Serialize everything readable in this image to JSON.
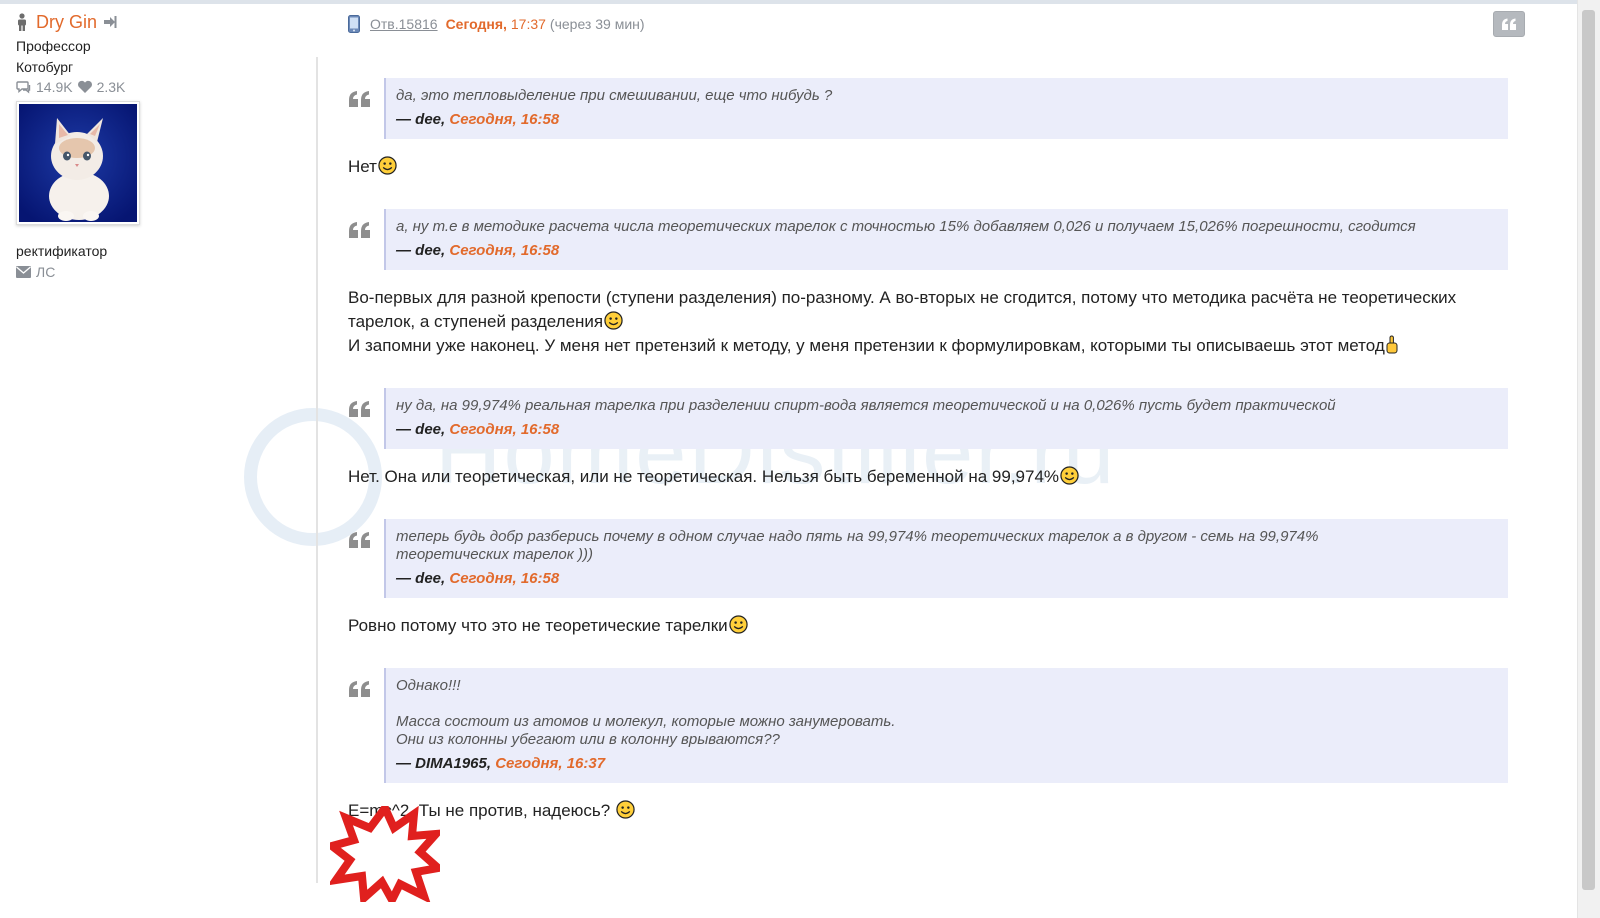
{
  "user": {
    "name": "Dry Gin",
    "rank": "Профессор",
    "city": "Котобург",
    "posts_count": "14.9K",
    "likes_count": "2.3K",
    "role": "ректификатор",
    "pm_label": "ЛС"
  },
  "post": {
    "number": "Отв.15816",
    "date": "Сегодня,",
    "time": "17:37",
    "delay": "(через 39 мин)"
  },
  "watermark": "HomeDistiller.ru",
  "blocks": [
    {
      "quote_lines": [
        "да, это тепловыделение при смешивании, еще что нибудь ?"
      ],
      "quote_author": "— dee,",
      "quote_time": "Сегодня, 16:58",
      "answer_lines": [
        "Нет"
      ]
    },
    {
      "quote_lines": [
        "а, ну т.е в методике расчета числа теоретических тарелок с точностью 15% добавляем 0,026 и получаем 15,026% погрешности, сгодится"
      ],
      "quote_author": "— dee,",
      "quote_time": "Сегодня, 16:58",
      "answer_lines": [
        "Во-первых для разной крепости (ступени разделения) по-разному. А во-вторых не сгодится, потому что методика расчёта не теоретических",
        "тарелок, а ступеней разделения",
        "И запомни уже наконец. У меня нет претензий к методу, у меня претензии к формулировкам, которыми ты описываешь этот метод"
      ]
    },
    {
      "quote_lines": [
        "ну да, на 99,974% реальная тарелка при разделении спирт-вода является теоретической и на 0,026% пусть будет практической"
      ],
      "quote_author": "— dee,",
      "quote_time": "Сегодня, 16:58",
      "answer_lines": [
        "Нет. Она или теоретическая, или не теоретическая. Нельзя быть беременной на 99,974%"
      ]
    },
    {
      "quote_lines": [
        "теперь будь добр разберись почему в одном случае надо пять на 99,974% теоретических тарелок а в другом - семь на 99,974%",
        "теоретических тарелок )))"
      ],
      "quote_author": "— dee,",
      "quote_time": "Сегодня, 16:58",
      "answer_lines": [
        "Ровно потому что это не теоретические тарелки"
      ]
    },
    {
      "quote_lines": [
        "Однако!!!",
        "Масса состоит из атомов и молекул, которые можно занумеровать.",
        "Они из колонны убегают или в колонну врываются??"
      ],
      "quote_author": "— DIMA1965,",
      "quote_time": "Сегодня, 16:37",
      "answer_lines": [
        "E=mc^2. Ты не против, надеюсь?"
      ]
    }
  ],
  "colors": {
    "accent": "#e26a2c",
    "quote_bg": "#ebedfa",
    "muted": "#8a8f96"
  },
  "icons": [
    "person-icon",
    "sign-in-icon",
    "comments-icon",
    "heart-icon",
    "envelope-icon",
    "mobile-icon",
    "quote-icon",
    "smiley-icon",
    "pointing-hand-icon",
    "burst-star-icon"
  ]
}
